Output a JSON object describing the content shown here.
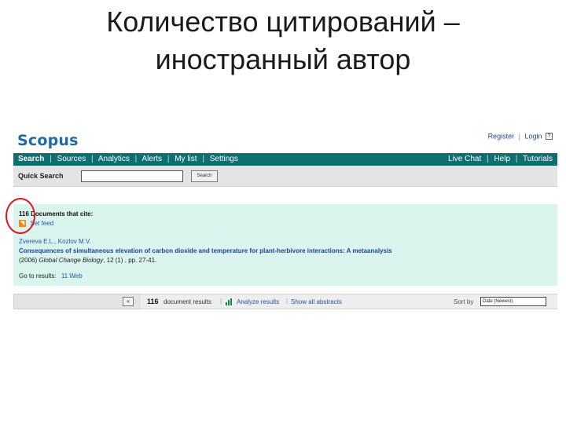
{
  "slide": {
    "title_line1": "Количество цитирований –",
    "title_line2": "иностранный автор"
  },
  "scopus": {
    "logo": "Scopus",
    "toplinks": {
      "register": "Register",
      "login": "Login",
      "separator": "|",
      "help_icon": "?"
    },
    "nav": {
      "items": [
        "Search",
        "Sources",
        "Analytics",
        "Alerts",
        "My list",
        "Settings"
      ],
      "right_items": [
        "Live Chat",
        "Help",
        "Tutorials"
      ],
      "active": "Search",
      "separator": "|"
    },
    "quick_search": {
      "label": "Quick Search",
      "value": "",
      "button_label": "Search"
    },
    "citing": {
      "count": "116",
      "label": "Documents that cite:",
      "rss_label": "Set feed",
      "rss_icon": "rss-icon",
      "authors": "Zvereva E.L., Kozlov M.V.",
      "document_title": "Consequences of simultaneous elevation of carbon dioxide and temperature for plant-herbivore interactions: A metaanalysis",
      "year": "(2006)",
      "journal": "Global Change Biology",
      "volume_pages": ", 12 (1) , pp. 27-41.",
      "goto_label": "Go to results:",
      "goto_link": "11 Web"
    },
    "results_bar": {
      "collapse_label": "«",
      "count": "116",
      "count_label": "document results",
      "analyze_label": "Analyze results",
      "show_abstracts_label": "Show all abstracts",
      "sort_label": "Sort by",
      "sort_value": "Date (Newest)",
      "separator": "|"
    }
  },
  "colors": {
    "nav_bg": "#0d6f70",
    "results_bg": "#d9f5ee",
    "logo": "#1f6aa5",
    "link": "#2255aa",
    "highlight": "#e0161b"
  }
}
